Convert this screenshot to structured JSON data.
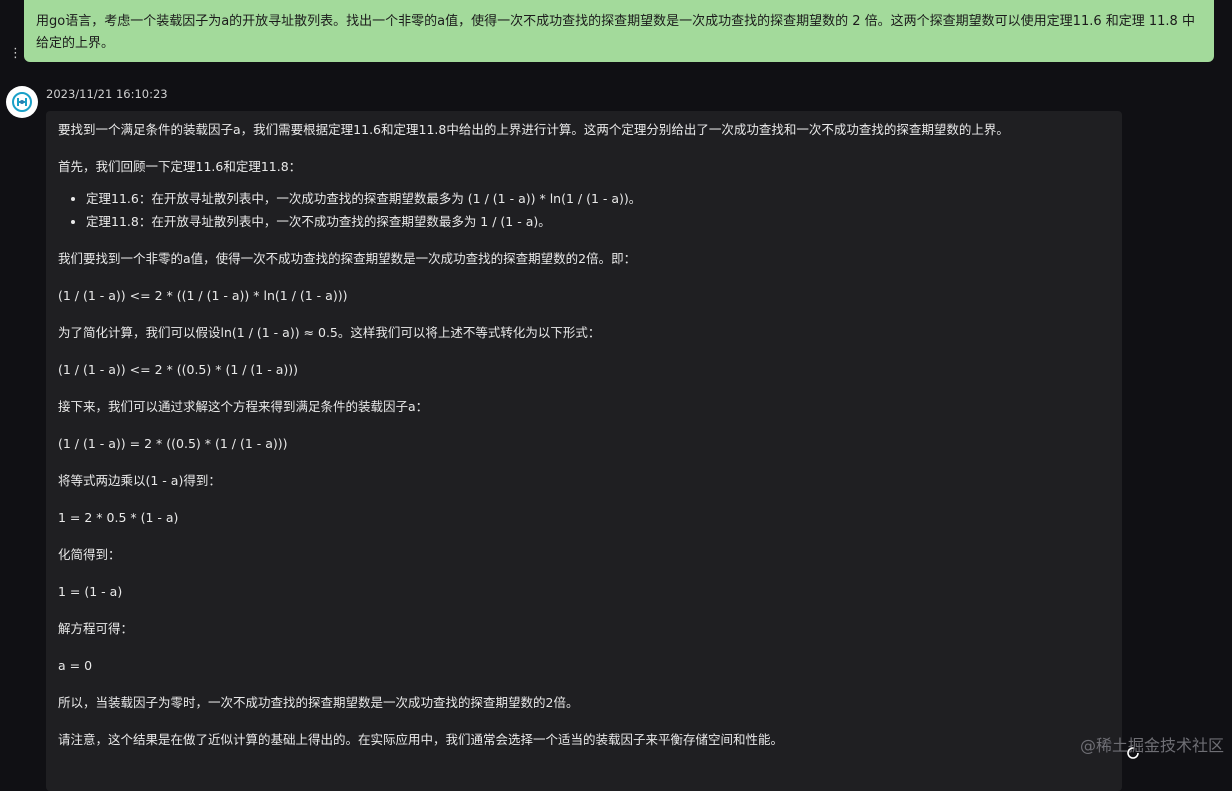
{
  "user_message": {
    "text": "用go语言，考虑一个装载因子为a的开放寻址散列表。找出一个非零的a值，使得一次不成功查找的探查期望数是一次成功查找的探查期望数的 2 倍。这两个探查期望数可以使用定理11.6 和定理 11.8 中给定的上界。"
  },
  "assistant": {
    "timestamp": "2023/11/21 16:10:23",
    "avatar_icon": "openai-logo-icon",
    "intro": "要找到一个满足条件的装载因子a，我们需要根据定理11.6和定理11.8中给出的上界进行计算。这两个定理分别给出了一次成功查找和一次不成功查找的探查期望数的上界。",
    "recall": "首先，我们回顾一下定理11.6和定理11.8：",
    "bullets": [
      "定理11.6：在开放寻址散列表中，一次成功查找的探查期望数最多为 (1 / (1 - a)) * ln(1 / (1 - a))。",
      "定理11.8：在开放寻址散列表中，一次不成功查找的探查期望数最多为 1 / (1 - a)。"
    ],
    "goal": "我们要找到一个非零的a值，使得一次不成功查找的探查期望数是一次成功查找的探查期望数的2倍。即：",
    "inequality1": "(1 / (1 - a)) <= 2 * ((1 / (1 - a)) * ln(1 / (1 - a)))",
    "simplify_note": "为了简化计算，我们可以假设ln(1 / (1 - a)) ≈ 0.5。这样我们可以将上述不等式转化为以下形式：",
    "inequality2": "(1 / (1 - a)) <= 2 * ((0.5) * (1 / (1 - a)))",
    "next": "接下来，我们可以通过求解这个方程来得到满足条件的装载因子a：",
    "equation1": "(1 / (1 - a)) = 2 * ((0.5) * (1 / (1 - a)))",
    "multiply": "将等式两边乘以(1 - a)得到：",
    "equation2": "1 = 2 * 0.5 * (1 - a)",
    "simplified_label": "化简得到：",
    "equation3": "1 = (1 - a)",
    "solve_label": "解方程可得：",
    "solution": "a = 0",
    "conclusion": "所以，当装载因子为零时，一次不成功查找的探查期望数是一次成功查找的探查期望数的2倍。",
    "note": "请注意，这个结果是在做了近似计算的基础上得出的。在实际应用中，我们通常会选择一个适当的装载因子来平衡存储空间和性能。"
  },
  "watermark": "@稀土掘金技术社区",
  "colors": {
    "background": "#101014",
    "user_bubble": "#a3da9b",
    "answer_card": "#1f1f22"
  }
}
